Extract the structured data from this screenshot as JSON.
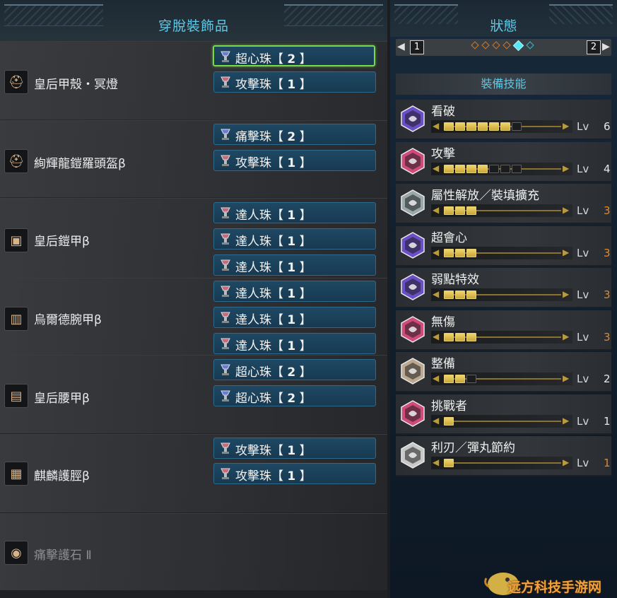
{
  "left_panel": {
    "title": "穿脫裝飾品",
    "equipment": [
      {
        "name": "皇后甲殼・冥燈",
        "icon": "helm-icon",
        "decorations": [
          {
            "name": "超心珠",
            "level": "2",
            "selected": true,
            "icon": "decoration-jewel-icon"
          },
          {
            "name": "攻擊珠",
            "level": "1",
            "selected": false,
            "icon": "decoration-jewel-icon"
          }
        ]
      },
      {
        "name": "絢輝龍鎧羅頭盔β",
        "icon": "helm-icon",
        "decorations": [
          {
            "name": "痛擊珠",
            "level": "2",
            "selected": false,
            "icon": "decoration-jewel-icon"
          },
          {
            "name": "攻擊珠",
            "level": "1",
            "selected": false,
            "icon": "decoration-jewel-icon"
          }
        ]
      },
      {
        "name": "皇后鎧甲β",
        "icon": "chest-armor-icon",
        "decorations": [
          {
            "name": "達人珠",
            "level": "1",
            "selected": false,
            "icon": "decoration-jewel-icon"
          },
          {
            "name": "達人珠",
            "level": "1",
            "selected": false,
            "icon": "decoration-jewel-icon"
          },
          {
            "name": "達人珠",
            "level": "1",
            "selected": false,
            "icon": "decoration-jewel-icon"
          }
        ]
      },
      {
        "name": "烏爾德腕甲β",
        "icon": "arm-armor-icon",
        "decorations": [
          {
            "name": "達人珠",
            "level": "1",
            "selected": false,
            "icon": "decoration-jewel-icon"
          },
          {
            "name": "達人珠",
            "level": "1",
            "selected": false,
            "icon": "decoration-jewel-icon"
          },
          {
            "name": "達人珠",
            "level": "1",
            "selected": false,
            "icon": "decoration-jewel-icon"
          }
        ]
      },
      {
        "name": "皇后腰甲β",
        "icon": "waist-armor-icon",
        "decorations": [
          {
            "name": "超心珠",
            "level": "2",
            "selected": false,
            "icon": "decoration-jewel-icon"
          },
          {
            "name": "超心珠",
            "level": "2",
            "selected": false,
            "icon": "decoration-jewel-icon"
          }
        ]
      },
      {
        "name": "麒麟護脛β",
        "icon": "leg-armor-icon",
        "decorations": [
          {
            "name": "攻擊珠",
            "level": "1",
            "selected": false,
            "icon": "decoration-jewel-icon"
          },
          {
            "name": "攻擊珠",
            "level": "1",
            "selected": false,
            "icon": "decoration-jewel-icon"
          }
        ]
      },
      {
        "name": "痛擊護石 Ⅱ",
        "icon": "charm-icon",
        "dim": true,
        "decorations": []
      }
    ]
  },
  "right_panel": {
    "title": "狀態",
    "pager": {
      "left_key": "1",
      "right_key": "2",
      "page_count": 6,
      "active_page": 5
    },
    "section_header": "裝備技能",
    "lv_label": "Lv",
    "skills": [
      {
        "name": "看破",
        "level": "6",
        "max": 7,
        "filled": 6,
        "color": "#6a4fc8",
        "value_color": "white"
      },
      {
        "name": "攻擊",
        "level": "4",
        "max": 7,
        "filled": 4,
        "color": "#d04a7a",
        "value_color": "white"
      },
      {
        "name": "屬性解放／裝填擴充",
        "level": "3",
        "max": 3,
        "filled": 3,
        "color": "#9aa8a8",
        "value_color": "orange"
      },
      {
        "name": "超會心",
        "level": "3",
        "max": 3,
        "filled": 3,
        "color": "#6a4fc8",
        "value_color": "orange"
      },
      {
        "name": "弱點特效",
        "level": "3",
        "max": 3,
        "filled": 3,
        "color": "#6a4fc8",
        "value_color": "orange"
      },
      {
        "name": "無傷",
        "level": "3",
        "max": 3,
        "filled": 3,
        "color": "#d04a7a",
        "value_color": "orange"
      },
      {
        "name": "整備",
        "level": "2",
        "max": 3,
        "filled": 2,
        "color": "#bda890",
        "value_color": "white"
      },
      {
        "name": "挑戰者",
        "level": "1",
        "max": 1,
        "filled": 1,
        "color": "#d04a7a",
        "value_color": "white"
      },
      {
        "name": "利刃／彈丸節約",
        "level": "1",
        "max": 1,
        "filled": 1,
        "color": "#c8c8c8",
        "value_color": "orange"
      }
    ]
  },
  "watermark": {
    "text": "远方科技手游网"
  }
}
